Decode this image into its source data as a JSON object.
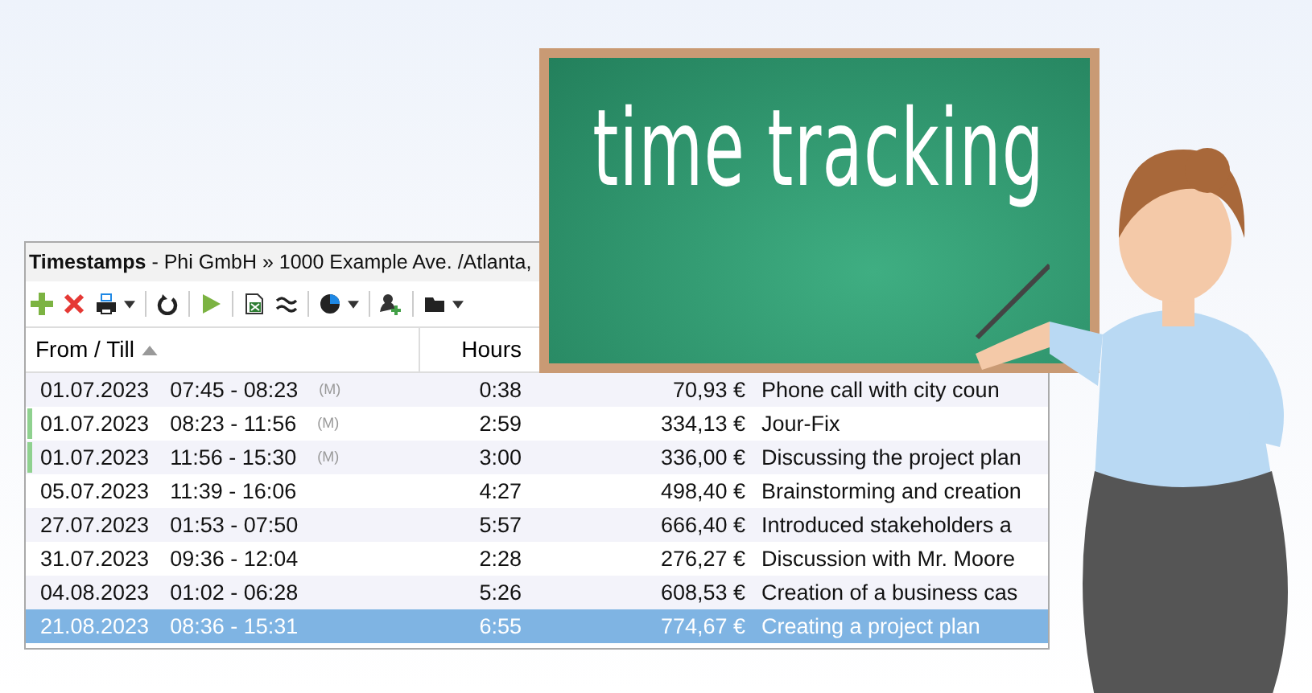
{
  "board": {
    "text": "time tracking"
  },
  "window": {
    "title": "**Timestamps** - Phi GmbH » 1000 Example Ave. /Atlanta,"
  },
  "table": {
    "columns": [
      {
        "label": "From / Till",
        "sorted": true
      },
      {
        "label": "Hours",
        "sorted": false
      }
    ],
    "rows": [
      {
        "date": "01.07.2023",
        "time": "07:45 - 08:23",
        "flag": "(M)",
        "hours": "0:38",
        "amount": "70,93 €",
        "description": "Phone call with city coun",
        "marked": false,
        "selected": false
      },
      {
        "date": "01.07.2023",
        "time": "08:23 - 11:56",
        "flag": "(M)",
        "hours": "2:59",
        "amount": "334,13 €",
        "description": "Jour-Fix",
        "marked": true,
        "selected": false
      },
      {
        "date": "01.07.2023",
        "time": "11:56 - 15:30",
        "flag": "(M)",
        "hours": "3:00",
        "amount": "336,00 €",
        "description": "Discussing the project plan",
        "marked": true,
        "selected": false
      },
      {
        "date": "05.07.2023",
        "time": "11:39 - 16:06",
        "hours": "4:27",
        "amount": "498,40 €",
        "description": "Brainstorming and creation",
        "marked": false,
        "selected": false
      },
      {
        "date": "27.07.2023",
        "time": "01:53 - 07:50",
        "hours": "5:57",
        "amount": "666,40 €",
        "description": "Introduced stakeholders a",
        "marked": false,
        "selected": false
      },
      {
        "date": "31.07.2023",
        "time": "09:36 - 12:04",
        "hours": "2:28",
        "amount": "276,27 €",
        "description": "Discussion with Mr. Moore",
        "marked": false,
        "selected": false
      },
      {
        "date": "04.08.2023",
        "time": "01:02 - 06:28",
        "hours": "5:26",
        "amount": "608,53 €",
        "description": "Creation of a business cas",
        "marked": false,
        "selected": false
      },
      {
        "date": "21.08.2023",
        "time": "08:36 - 15:31",
        "hours": "6:55",
        "amount": "774,67 €",
        "description": "Creating a project plan",
        "marked": false,
        "selected": true
      }
    ]
  }
}
